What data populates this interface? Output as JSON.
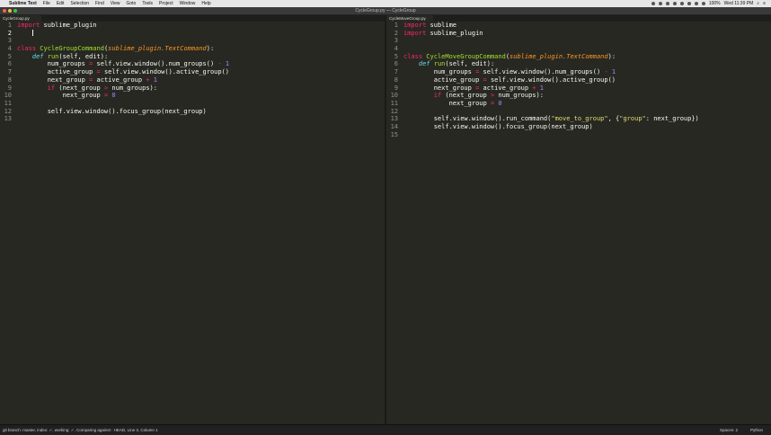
{
  "menubar": {
    "app": "Sublime Text",
    "items": [
      "File",
      "Edit",
      "Selection",
      "Find",
      "View",
      "Goto",
      "Tools",
      "Project",
      "Window",
      "Help"
    ],
    "battery": "100%",
    "clock": "Wed 11:39 PM"
  },
  "window": {
    "title": "CycleGroup.py — CycleGroup"
  },
  "panes": [
    {
      "tab": "CycleGroup.py",
      "lines": [
        {
          "n": "1",
          "t": "import sublime_plugin"
        },
        {
          "n": "2",
          "t": ""
        },
        {
          "n": "3",
          "t": ""
        },
        {
          "n": "4",
          "t": "class CycleGroupCommand(sublime_plugin.TextCommand):"
        },
        {
          "n": "5",
          "t": "    def run(self, edit):"
        },
        {
          "n": "6",
          "t": "        num_groups = self.view.window().num_groups() - 1"
        },
        {
          "n": "7",
          "t": "        active_group = self.view.window().active_group()"
        },
        {
          "n": "8",
          "t": "        next_group = active_group + 1"
        },
        {
          "n": "9",
          "t": "        if (next_group > num_groups):"
        },
        {
          "n": "10",
          "t": "            next_group = 0"
        },
        {
          "n": "11",
          "t": ""
        },
        {
          "n": "12",
          "t": "        self.view.window().focus_group(next_group)"
        },
        {
          "n": "13",
          "t": ""
        }
      ]
    },
    {
      "tab": "CycleMoveGroup.py",
      "lines": [
        {
          "n": "1",
          "t": "import sublime"
        },
        {
          "n": "2",
          "t": "import sublime_plugin"
        },
        {
          "n": "3",
          "t": ""
        },
        {
          "n": "4",
          "t": ""
        },
        {
          "n": "5",
          "t": "class CycleMoveGroupCommand(sublime_plugin.TextCommand):"
        },
        {
          "n": "6",
          "t": "    def run(self, edit):"
        },
        {
          "n": "7",
          "t": "        num_groups = self.view.window().num_groups() - 1"
        },
        {
          "n": "8",
          "t": "        active_group = self.view.window().active_group()"
        },
        {
          "n": "9",
          "t": "        next_group = active_group + 1"
        },
        {
          "n": "10",
          "t": "        if (next_group > num_groups):"
        },
        {
          "n": "11",
          "t": "            next_group = 0"
        },
        {
          "n": "12",
          "t": ""
        },
        {
          "n": "13",
          "t": "        self.view.window().run_command(\"move_to_group\", {\"group\": next_group})"
        },
        {
          "n": "14",
          "t": "        self.view.window().focus_group(next_group)"
        },
        {
          "n": "15",
          "t": ""
        }
      ]
    }
  ],
  "statusbar": {
    "left": "git branch: master, index: ✓, working: ✓, Comparing against : HEAD, Line 3, Column 1",
    "spaces": "Spaces: 2",
    "syntax": "Python"
  },
  "colors": {
    "background": "#272822",
    "keyword": "#f92672",
    "class_name": "#a6e22e",
    "inherited": "#fd971f",
    "number": "#ae81ff",
    "string": "#e6db74"
  }
}
